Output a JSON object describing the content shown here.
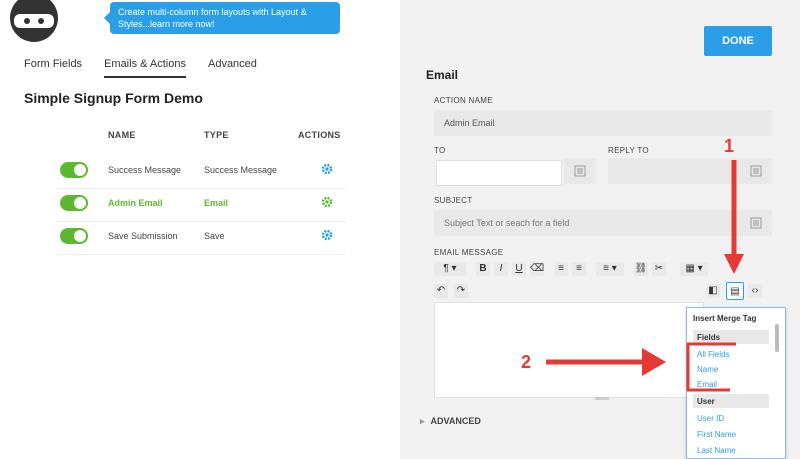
{
  "promo": {
    "text": "Create multi-column form layouts with Layout & Styles...learn more now!"
  },
  "tabs": [
    {
      "label": "Form Fields"
    },
    {
      "label": "Emails & Actions"
    },
    {
      "label": "Advanced"
    }
  ],
  "form_title": "Simple Signup Form Demo",
  "table": {
    "headers": {
      "name": "NAME",
      "type": "TYPE",
      "actions": "ACTIONS"
    },
    "rows": [
      {
        "name": "Success Message",
        "type": "Success Message"
      },
      {
        "name": "Admin Email",
        "type": "Email"
      },
      {
        "name": "Save Submission",
        "type": "Save"
      }
    ]
  },
  "done_label": "DONE",
  "section_title": "Email",
  "labels": {
    "action_name": "ACTION NAME",
    "to": "TO",
    "reply_to": "REPLY TO",
    "subject": "SUBJECT",
    "email_message": "EMAIL MESSAGE",
    "advanced": "ADVANCED"
  },
  "fields": {
    "action_name": "Admin Email",
    "subject_placeholder": "Subject Text or seach for a field"
  },
  "merge_tag": {
    "title": "Insert Merge Tag",
    "groups": [
      {
        "label": "Fields",
        "items": [
          "All Fields",
          "Name",
          "Email"
        ]
      },
      {
        "label": "User",
        "items": [
          "User ID",
          "First Name",
          "Last Name"
        ]
      }
    ]
  },
  "annotations": {
    "marker_1": "1",
    "marker_2": "2"
  },
  "colors": {
    "accent": "#2b9ee8",
    "toggle_on": "#5cb82e",
    "annotation": "#e53935"
  }
}
